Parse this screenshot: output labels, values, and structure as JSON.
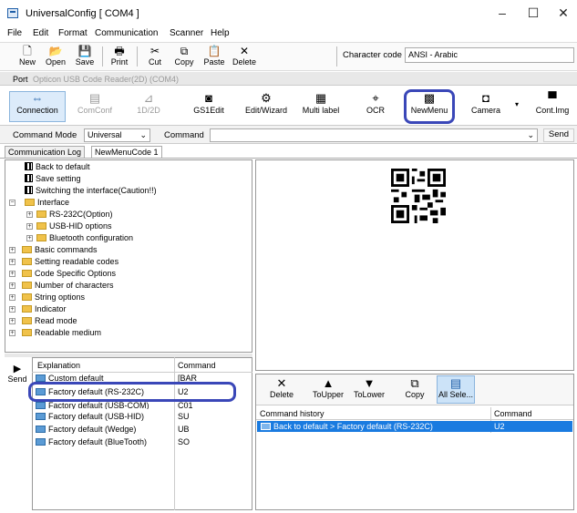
{
  "window": {
    "title": "UniversalConfig [ COM4 ]",
    "controls": [
      "–",
      "☐",
      "✕"
    ]
  },
  "menu": [
    "File",
    "Edit",
    "Format",
    "Communication",
    "Scanner",
    "Help"
  ],
  "toolbar": {
    "new": "New",
    "open": "Open",
    "save": "Save",
    "print": "Print",
    "cut": "Cut",
    "copy": "Copy",
    "paste": "Paste",
    "delete": "Delete",
    "character_code_label": "Character code",
    "character_code_value": "ANSI - Arabic"
  },
  "port": {
    "label": "Port",
    "value": "Opticon USB Code Reader(2D) (COM4)"
  },
  "toolbar2": {
    "connection": "Connection",
    "comconf": "ComConf",
    "one_d_two_d": "1D/2D",
    "gs1edit": "GS1Edit",
    "edit_wizard": "Edit/Wizard",
    "multi_label": "Multi label",
    "ocr": "OCR",
    "newmenu": "NewMenu",
    "camera": "Camera",
    "contimg": "Cont.Img"
  },
  "command_row": {
    "mode_label": "Command Mode",
    "mode_value": "Universal",
    "command_label": "Command",
    "command_value": "",
    "send": "Send"
  },
  "tabs": [
    "Communication Log",
    "NewMenuCode 1"
  ],
  "tree": [
    "Back to default",
    "Save setting",
    "Switching the interface(Caution!!)",
    "Interface",
    "RS-232C(Option)",
    "USB-HID options",
    "Bluetooth configuration",
    "Basic commands",
    "Setting readable codes",
    "Code Specific Options",
    "Number of characters",
    "String options",
    "Indicator",
    "Read mode",
    "Readable medium"
  ],
  "left_send": "Send",
  "explanation_list": {
    "headers": [
      "Explanation",
      "Command"
    ],
    "rows": [
      [
        "Custom default",
        "[BAR"
      ],
      [
        "Factory default (RS-232C)",
        "U2"
      ],
      [
        "Factory default (USB-COM)",
        "C01"
      ],
      [
        "Factory default (USB-HID)",
        "SU"
      ],
      [
        "Factory default (Wedge)",
        "UB"
      ],
      [
        "Factory default (BlueTooth)",
        "SO"
      ]
    ]
  },
  "history_toolbar": {
    "delete": "Delete",
    "toupper": "ToUpper",
    "tolower": "ToLower",
    "copy": "Copy",
    "all_select": "All Sele..."
  },
  "history": {
    "headers": [
      "Command history",
      "Command"
    ],
    "rows": [
      [
        "Back to default > Factory default (RS-232C)",
        "U2"
      ]
    ]
  },
  "colors": {
    "highlight_outline": "#3a47b8",
    "selection": "#1a7be0",
    "folder": "#f0c24a"
  }
}
